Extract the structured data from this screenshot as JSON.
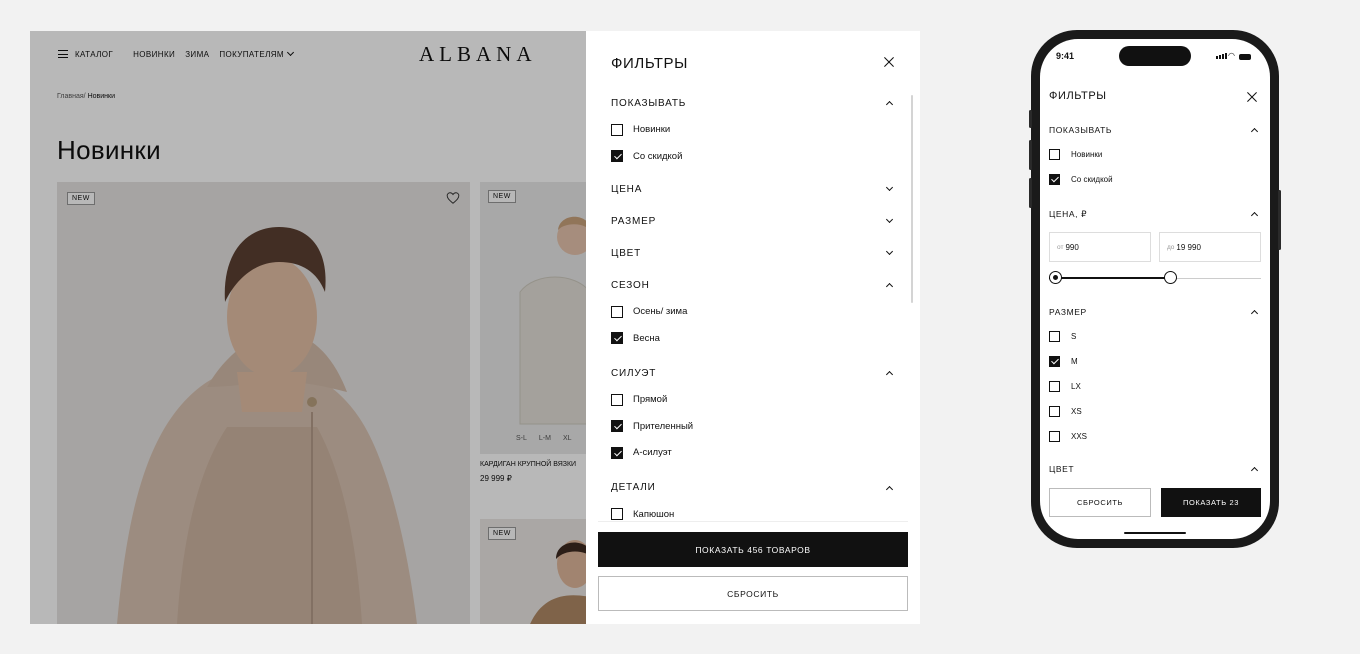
{
  "desktop": {
    "header": {
      "catalog": "КАТАЛОГ",
      "nav": [
        "НОВИНКИ",
        "ЗИМА",
        "ПОКУПАТЕЛЯМ"
      ],
      "logo": "ALBANA"
    },
    "breadcrumb": {
      "home": "Главная",
      "separator": "/",
      "current": "Новинки"
    },
    "page_title": "Новинки",
    "products": {
      "badge": "NEW",
      "sizes": [
        "S-L",
        "L-M",
        "XL"
      ],
      "name": "КАРДИГАН КРУПНОЙ ВЯЗКИ",
      "price": "29 999 ₽"
    },
    "filters": {
      "title": "ФИЛЬТРЫ",
      "sections": [
        {
          "title": "ПОКАЗЫВАТЬ",
          "expanded": true,
          "options": [
            {
              "label": "Новинки",
              "checked": false
            },
            {
              "label": "Со скидкой",
              "checked": true
            }
          ]
        },
        {
          "title": "ЦЕНА",
          "expanded": false,
          "options": []
        },
        {
          "title": "РАЗМЕР",
          "expanded": false,
          "options": []
        },
        {
          "title": "ЦВЕТ",
          "expanded": false,
          "options": []
        },
        {
          "title": "СЕЗОН",
          "expanded": true,
          "options": [
            {
              "label": "Осень/ зима",
              "checked": false
            },
            {
              "label": "Весна",
              "checked": true
            }
          ]
        },
        {
          "title": "СИЛУЭТ",
          "expanded": true,
          "options": [
            {
              "label": "Прямой",
              "checked": false
            },
            {
              "label": "Прителенный",
              "checked": true
            },
            {
              "label": "А-силуэт",
              "checked": true
            }
          ]
        },
        {
          "title": "ДЕТАЛИ",
          "expanded": true,
          "options": [
            {
              "label": "Капюшон",
              "checked": false
            }
          ]
        }
      ],
      "apply_label": "ПОКАЗАТЬ 456 ТОВАРОВ",
      "reset_label": "СБРОСИТЬ"
    }
  },
  "mobile": {
    "status": {
      "time": "9:41"
    },
    "title": "ФИЛЬТРЫ",
    "show_section": {
      "title": "ПОКАЗЫВАТЬ",
      "options": [
        {
          "label": "Новинки",
          "checked": false
        },
        {
          "label": "Со скидкой",
          "checked": true
        }
      ]
    },
    "price": {
      "title": "ЦЕНА, ₽",
      "from_prefix": "от",
      "from_value": "990",
      "to_prefix": "до",
      "to_value": "19 990",
      "slider_fraction": 0.57
    },
    "size_section": {
      "title": "РАЗМЕР",
      "options": [
        {
          "label": "S",
          "checked": false
        },
        {
          "label": "M",
          "checked": true
        },
        {
          "label": "LX",
          "checked": false
        },
        {
          "label": "XS",
          "checked": false
        },
        {
          "label": "XXS",
          "checked": false
        }
      ]
    },
    "color_section": {
      "title": "ЦВЕТ"
    },
    "reset_label": "СБРОСИТЬ",
    "apply_label": "ПОКАЗАТЬ 23"
  }
}
